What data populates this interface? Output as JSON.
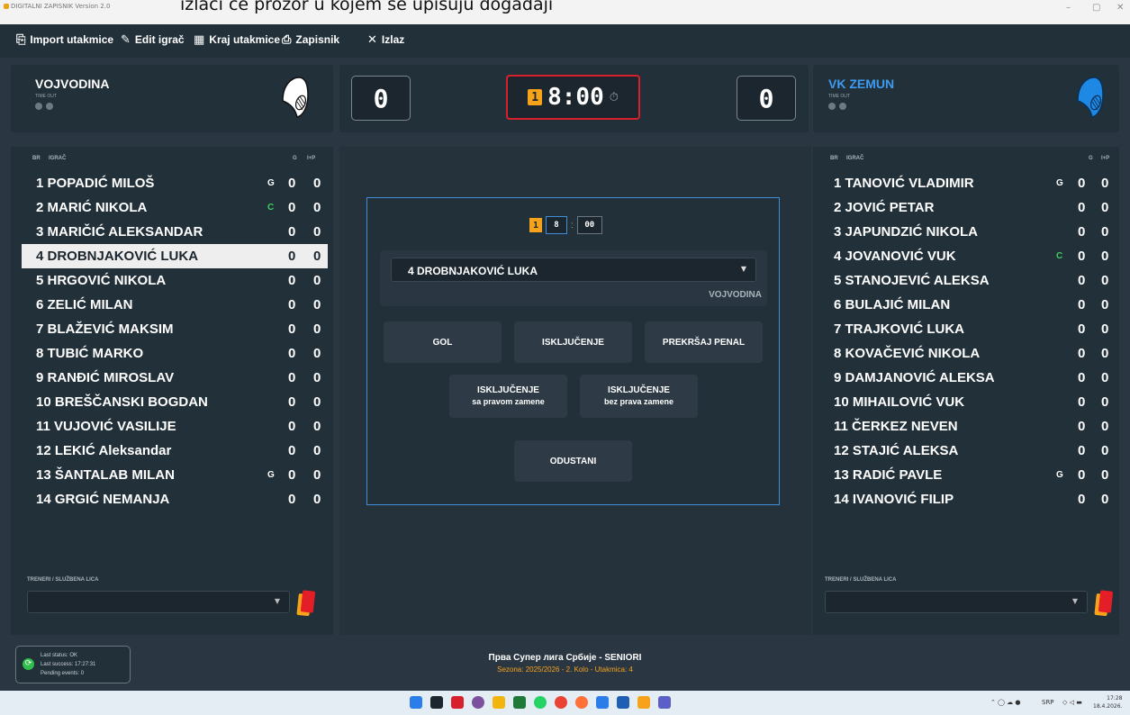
{
  "caption": "izlaći će prozor u kojem se upisuju događaji",
  "window": {
    "title": "DIGITALNI ZAPISNIK Version 2.0",
    "minimize": "–",
    "maximize": "▢",
    "close": "✕"
  },
  "menu": [
    {
      "icon": "clipboard-icon",
      "glyph": "⎘",
      "label": "Import utakmice"
    },
    {
      "icon": "pencil-icon",
      "glyph": "✎",
      "label": "Edit igrač"
    },
    {
      "icon": "flag-icon",
      "glyph": "▦",
      "label": "Kraj utakmice"
    },
    {
      "icon": "printer-icon",
      "glyph": "⎙",
      "label": "Zapisnik"
    },
    {
      "icon": "close-icon",
      "glyph": "✕",
      "label": "Izlaz"
    }
  ],
  "home": {
    "name": "VOJVODINA",
    "timeout_label": "TIME OUT",
    "score": "0",
    "cap_color": "#ffffff"
  },
  "away": {
    "name": "VK ZEMUN",
    "timeout_label": "TIME OUT",
    "score": "0",
    "cap_color": "#1e88e5",
    "name_color": "#3f9bf0"
  },
  "clock": {
    "period": "1",
    "time": "8:00",
    "icon": "stopwatch-icon"
  },
  "columns": {
    "no": "BR",
    "player": "IGRAČ",
    "goals": "G",
    "ip": "I+P"
  },
  "home_players": [
    {
      "no": "1",
      "name": "POPADIĆ MILOŠ",
      "role": "G",
      "g": "0",
      "ip": "0"
    },
    {
      "no": "2",
      "name": "MARIĆ NIKOLA",
      "role": "C",
      "g": "0",
      "ip": "0"
    },
    {
      "no": "3",
      "name": "MARIČIĆ ALEKSANDAR",
      "role": "",
      "g": "0",
      "ip": "0"
    },
    {
      "no": "4",
      "name": "DROBNJAKOVIĆ LUKA",
      "role": "",
      "g": "0",
      "ip": "0",
      "selected": true
    },
    {
      "no": "5",
      "name": "HRGOVIĆ NIKOLA",
      "role": "",
      "g": "0",
      "ip": "0"
    },
    {
      "no": "6",
      "name": "ZELIĆ MILAN",
      "role": "",
      "g": "0",
      "ip": "0"
    },
    {
      "no": "7",
      "name": "BLAŽEVIĆ MAKSIM",
      "role": "",
      "g": "0",
      "ip": "0"
    },
    {
      "no": "8",
      "name": "TUBIĆ MARKO",
      "role": "",
      "g": "0",
      "ip": "0"
    },
    {
      "no": "9",
      "name": "RANĐIĆ MIROSLAV",
      "role": "",
      "g": "0",
      "ip": "0"
    },
    {
      "no": "10",
      "name": "BREŠČANSKI BOGDAN",
      "role": "",
      "g": "0",
      "ip": "0"
    },
    {
      "no": "11",
      "name": "VUJOVIĆ VASILIJE",
      "role": "",
      "g": "0",
      "ip": "0"
    },
    {
      "no": "12",
      "name": "LEKIĆ Aleksandar",
      "role": "",
      "g": "0",
      "ip": "0"
    },
    {
      "no": "13",
      "name": "ŠANTALAB MILAN",
      "role": "G",
      "g": "0",
      "ip": "0"
    },
    {
      "no": "14",
      "name": "GRGIĆ NEMANJA",
      "role": "",
      "g": "0",
      "ip": "0"
    }
  ],
  "away_players": [
    {
      "no": "1",
      "name": "TANOVIĆ VLADIMIR",
      "role": "G",
      "g": "0",
      "ip": "0"
    },
    {
      "no": "2",
      "name": "JOVIĆ PETAR",
      "role": "",
      "g": "0",
      "ip": "0"
    },
    {
      "no": "3",
      "name": "JAPUNDZIĆ NIKOLA",
      "role": "",
      "g": "0",
      "ip": "0"
    },
    {
      "no": "4",
      "name": "JOVANOVIĆ VUK",
      "role": "C",
      "g": "0",
      "ip": "0"
    },
    {
      "no": "5",
      "name": "STANOJEVIĆ ALEKSA",
      "role": "",
      "g": "0",
      "ip": "0"
    },
    {
      "no": "6",
      "name": "BULAJIĆ MILAN",
      "role": "",
      "g": "0",
      "ip": "0"
    },
    {
      "no": "7",
      "name": "TRAJKOVIĆ LUKA",
      "role": "",
      "g": "0",
      "ip": "0"
    },
    {
      "no": "8",
      "name": "KOVAČEVIĆ NIKOLA",
      "role": "",
      "g": "0",
      "ip": "0"
    },
    {
      "no": "9",
      "name": "DAMJANOVIĆ ALEKSA",
      "role": "",
      "g": "0",
      "ip": "0"
    },
    {
      "no": "10",
      "name": "MIHAILOVIĆ VUK",
      "role": "",
      "g": "0",
      "ip": "0"
    },
    {
      "no": "11",
      "name": "ČERKEZ NEVEN",
      "role": "",
      "g": "0",
      "ip": "0"
    },
    {
      "no": "12",
      "name": "STAJIĆ ALEKSA",
      "role": "",
      "g": "0",
      "ip": "0"
    },
    {
      "no": "13",
      "name": "RADIĆ PAVLE",
      "role": "G",
      "g": "0",
      "ip": "0"
    },
    {
      "no": "14",
      "name": "IVANOVIĆ FILIP",
      "role": "",
      "g": "0",
      "ip": "0"
    }
  ],
  "officials_label": "TRENERI / SLUŽBENA LICA",
  "dialog": {
    "period": "1",
    "minutes": "8",
    "separator": ":",
    "seconds": "00",
    "selected_player": "4 DROBNJAKOVIĆ LUKA",
    "team": "VOJVODINA",
    "btn_goal": "GOL",
    "btn_exclusion": "ISKLJUČENJE",
    "btn_penalty": "PREKRŠAJ PENAL",
    "btn_excl_with": "ISKLJUČENJE",
    "btn_excl_with_sub": "sa pravom zamene",
    "btn_excl_without": "ISKLJUČENJE",
    "btn_excl_without_sub": "bez prava zamene",
    "btn_cancel": "ODUSTANI"
  },
  "status": {
    "line1": "Last status: OK",
    "line2": "Last success: 17:27:31",
    "line3": "Pending events: 0"
  },
  "footer": {
    "league": "Прва Супер лига Србије - SENIORI",
    "season": "Sezona: 2025/2026 - 2. Kolo - Utakmica: 4"
  },
  "taskbar": {
    "lang": "SRP",
    "time": "17:28",
    "date": "18.4.2026."
  },
  "colors": {
    "accent": "#f7a21b",
    "clock_border": "#d7202b",
    "dialog_border": "#3f8ed8",
    "captain": "#3ecf5a"
  }
}
